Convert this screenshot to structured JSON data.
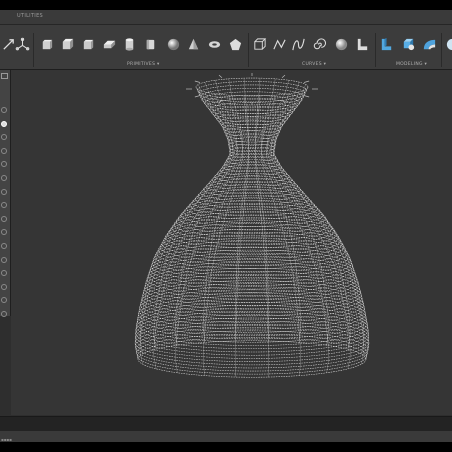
{
  "app": {
    "section_label": "UTILITIES"
  },
  "toolbar": {
    "groups": [
      {
        "label": "PRIMITIVES ▾",
        "key": "primitives"
      },
      {
        "label": "CURVES ▾",
        "key": "curves"
      },
      {
        "label": "MODELING ▾",
        "key": "modeling"
      }
    ],
    "tools": [
      {
        "name": "move-icon"
      },
      {
        "name": "transform-icon"
      },
      {
        "name": "box-primitive-icon"
      },
      {
        "name": "cube-primitive-icon"
      },
      {
        "name": "wedge-primitive-icon"
      },
      {
        "name": "slab-primitive-icon"
      },
      {
        "name": "cylinder-primitive-icon"
      },
      {
        "name": "sphere-primitive-icon"
      },
      {
        "name": "cone-primitive-icon"
      },
      {
        "name": "torus-primitive-icon"
      },
      {
        "name": "polygon-primitive-icon"
      },
      {
        "name": "wire-cube-icon"
      },
      {
        "name": "polyline-icon"
      },
      {
        "name": "spline-icon"
      },
      {
        "name": "spiral-icon"
      },
      {
        "name": "surface-sphere-icon"
      },
      {
        "name": "plane-profile-icon"
      },
      {
        "name": "extrude-icon"
      },
      {
        "name": "boolean-icon"
      },
      {
        "name": "fillet-icon"
      },
      {
        "name": "globe-icon"
      }
    ]
  },
  "left_panel": {
    "item_count": 16,
    "active_index": 1
  },
  "viewport": {
    "object": "vase-wireframe-mesh",
    "colors": {
      "background": "#353535",
      "wire": "#f2f2f2"
    }
  }
}
